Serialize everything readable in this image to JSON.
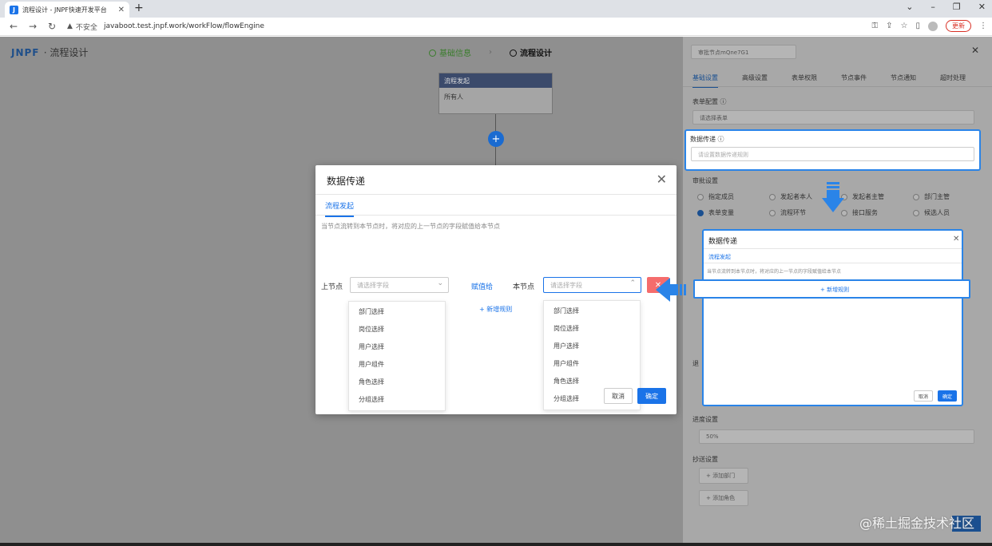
{
  "browser": {
    "tab_title": "流程设计 - JNPF快速开发平台",
    "security_label": "不安全",
    "url": "javaboot.test.jnpf.work/workFlow/flowEngine",
    "update_label": "更新"
  },
  "app": {
    "logo": "JNPF",
    "logo_sub": "· 流程设计",
    "step1": "基础信息",
    "step2": "流程设计"
  },
  "flow": {
    "node_title": "流程发起",
    "node_body": "所有人"
  },
  "modal": {
    "title": "数据传递",
    "tab": "流程发起",
    "hint": "当节点流转到本节点时，将对应的上一节点的字段赋值给本节点",
    "upper_label": "上节点",
    "upper_placeholder": "请选择字段",
    "assign_label": "赋值给",
    "this_label": "本节点",
    "this_placeholder": "请选择字段",
    "add_rule": "+ 新增规则",
    "cancel": "取消",
    "ok": "确定",
    "options": [
      "部门选择",
      "岗位选择",
      "用户选择",
      "用户组件",
      "角色选择",
      "分组选择"
    ]
  },
  "panel": {
    "node_id": "审批节点mQne7G1",
    "tabs": [
      "基础设置",
      "高级设置",
      "表单权限",
      "节点事件",
      "节点通知",
      "超时处理"
    ],
    "form_config": "表单配置",
    "form_placeholder": "请选择表单",
    "data_pass": "数据传递",
    "data_pass_placeholder": "请设置数据传递规则",
    "approval_label": "审批设置",
    "approvers_row1": [
      "指定成员",
      "发起者本人",
      "发起者主管",
      "部门主管"
    ],
    "approvers_row2": [
      "表单变量",
      "流程环节",
      "接口服务",
      "候选人员"
    ],
    "progress_label": "进度设置",
    "progress_value": "50%",
    "cc_label": "抄送设置",
    "add_dept": "+ 添加部门",
    "add_role": "+ 添加角色",
    "back_label": "退"
  },
  "mini": {
    "title": "数据传递",
    "tab": "流程发起",
    "hint": "当节点流转到本节点时，将对应的上一节点的字段赋值给本节点",
    "add_rule": "+ 新增规则",
    "cancel": "取消",
    "ok": "确定"
  },
  "watermark": "@稀土掘金技术社区"
}
